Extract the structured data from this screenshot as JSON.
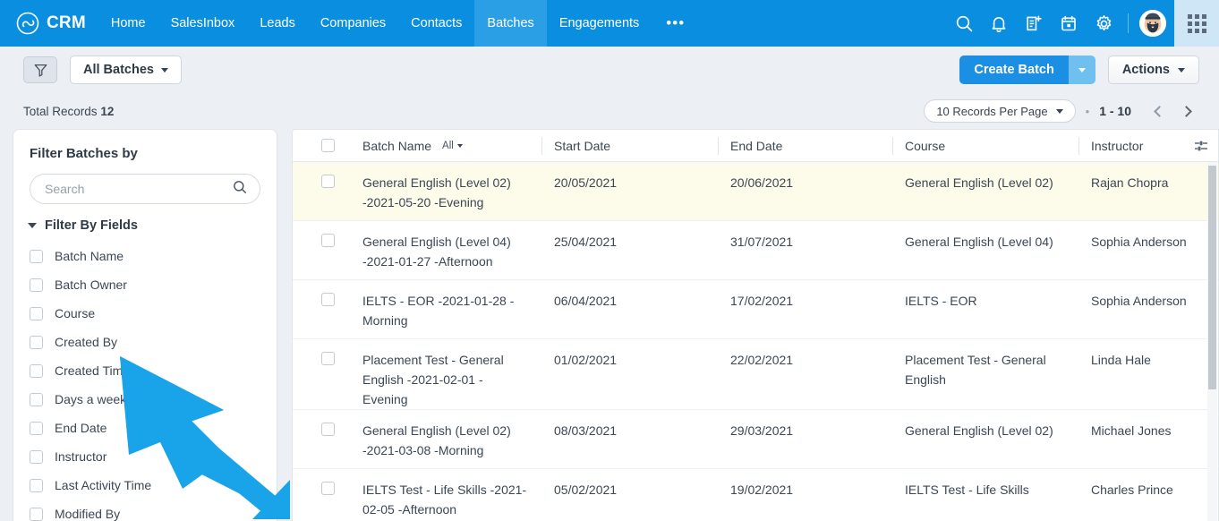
{
  "colors": {
    "nav_blue": "#0a8fe0",
    "nav_active_blue": "#2b9fe6",
    "primary_blue": "#1a8fe3",
    "page_bg": "#eceff3",
    "row_highlight": "#fdfbea",
    "annotation_arrow": "#19a3e8"
  },
  "topnav": {
    "brand": "CRM",
    "brand_logo_icon": "infinity-loop-logo-icon",
    "links": [
      {
        "label": "Home",
        "active": false
      },
      {
        "label": "SalesInbox",
        "active": false
      },
      {
        "label": "Leads",
        "active": false
      },
      {
        "label": "Companies",
        "active": false
      },
      {
        "label": "Contacts",
        "active": false
      },
      {
        "label": "Batches",
        "active": true
      },
      {
        "label": "Engagements",
        "active": false
      }
    ],
    "more_label": "•••",
    "icons": [
      {
        "name": "search-icon"
      },
      {
        "name": "bell-notification-icon"
      },
      {
        "name": "note-add-icon"
      },
      {
        "name": "calendar-icon"
      },
      {
        "name": "gear-settings-icon"
      }
    ],
    "avatar_name": "user-avatar",
    "apps_grid_name": "apps-grid-icon"
  },
  "toolbar": {
    "filter_icon": "funnel-filter-icon",
    "view_selector_label": "All Batches",
    "create_label": "Create Batch",
    "create_caret_name": "create-batch-dropdown-caret",
    "actions_label": "Actions"
  },
  "records_bar": {
    "total_label": "Total Records",
    "total_count": "12",
    "per_page_label": "10 Records Per Page",
    "separator": "•",
    "range_label": "1 - 10",
    "prev_icon": "chevron-left-icon",
    "next_icon": "chevron-right-icon"
  },
  "sidebar": {
    "title": "Filter Batches by",
    "search_placeholder": "Search",
    "search_value": "",
    "search_icon": "search-icon",
    "section_label": "Filter By Fields",
    "fields": [
      {
        "label": "Batch Name",
        "checked": false
      },
      {
        "label": "Batch Owner",
        "checked": false
      },
      {
        "label": "Course",
        "checked": false
      },
      {
        "label": "Created By",
        "checked": false
      },
      {
        "label": "Created Time",
        "checked": false
      },
      {
        "label": "Days a week",
        "checked": false
      },
      {
        "label": "End Date",
        "checked": false
      },
      {
        "label": "Instructor",
        "checked": false
      },
      {
        "label": "Last Activity Time",
        "checked": false
      },
      {
        "label": "Modified By",
        "checked": false
      }
    ]
  },
  "table": {
    "columns": {
      "batch_name": "Batch Name",
      "batch_name_filter": "All",
      "start_date": "Start Date",
      "end_date": "End Date",
      "course": "Course",
      "instructor": "Instructor"
    },
    "column_settings_icon": "column-settings-icon",
    "rows": [
      {
        "name": "General English (Level 02) -2021-05-20 -Evening",
        "start_date": "20/05/2021",
        "end_date": "20/06/2021",
        "course": "General English (Level 02)",
        "instructor": "Rajan Chopra",
        "highlighted": true
      },
      {
        "name": "General English (Level 04) -2021-01-27 -Afternoon",
        "start_date": "25/04/2021",
        "end_date": "31/07/2021",
        "course": "General English (Level 04)",
        "instructor": "Sophia Anderson",
        "highlighted": false
      },
      {
        "name": "IELTS - EOR -2021-01-28 - Morning",
        "start_date": "06/04/2021",
        "end_date": "17/02/2021",
        "course": "IELTS - EOR",
        "instructor": "Sophia Anderson",
        "highlighted": false
      },
      {
        "name": "Placement Test - General English -2021-02-01 - Evening",
        "start_date": "01/02/2021",
        "end_date": "22/02/2021",
        "course": "Placement Test - General English",
        "instructor": "Linda Hale",
        "highlighted": false
      },
      {
        "name": "General English (Level 02) -2021-03-08 -Morning",
        "start_date": "08/03/2021",
        "end_date": "29/03/2021",
        "course": "General English (Level 02)",
        "instructor": "Michael Jones",
        "highlighted": false
      },
      {
        "name": "IELTS Test - Life Skills -2021-02-05 -Afternoon",
        "start_date": "05/02/2021",
        "end_date": "19/02/2021",
        "course": "IELTS Test - Life Skills",
        "instructor": "Charles Prince",
        "highlighted": false
      }
    ]
  },
  "annotation": {
    "arrow_name": "pointer-arrow-annotation"
  }
}
